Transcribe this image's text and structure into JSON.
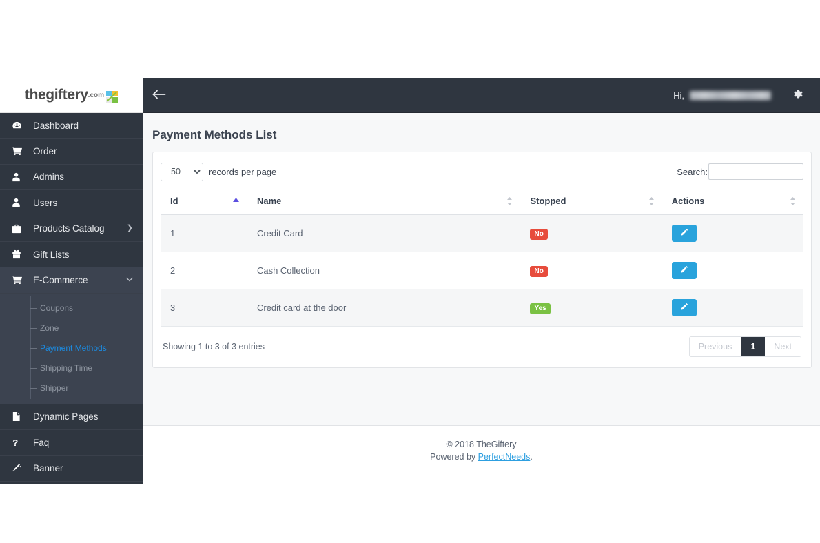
{
  "brand": {
    "name": "thegiftery",
    "suffix": ".com",
    "mark_icon": "gift-squares-logo-icon"
  },
  "sidebar": {
    "items": [
      {
        "label": "Dashboard",
        "icon": "dashboard-icon",
        "glyph": "◔",
        "caret": "",
        "active": false
      },
      {
        "label": "Order",
        "icon": "cart-icon",
        "glyph": "🛒",
        "caret": "",
        "active": false
      },
      {
        "label": "Admins",
        "icon": "user-icon",
        "glyph": "👤",
        "caret": "",
        "active": false
      },
      {
        "label": "Users",
        "icon": "user-icon",
        "glyph": "👤",
        "caret": "",
        "active": false
      },
      {
        "label": "Products Catalog",
        "icon": "briefcase-icon",
        "glyph": "💼",
        "caret": "❯",
        "active": false
      },
      {
        "label": "Gift Lists",
        "icon": "gift-icon",
        "glyph": "🎁",
        "caret": "",
        "active": false
      },
      {
        "label": "E-Commerce",
        "icon": "cart-icon",
        "glyph": "🛒",
        "caret": "⌄",
        "active": true
      }
    ],
    "submenu": [
      {
        "label": "Coupons",
        "active": false
      },
      {
        "label": "Zone",
        "active": false
      },
      {
        "label": "Payment Methods",
        "active": true
      },
      {
        "label": "Shipping Time",
        "active": false
      },
      {
        "label": "Shipper",
        "active": false
      }
    ],
    "items_bottom": [
      {
        "label": "Dynamic Pages",
        "icon": "file-icon",
        "glyph": "🗎"
      },
      {
        "label": "Faq",
        "icon": "question-mark-icon",
        "glyph": "?"
      },
      {
        "label": "Banner",
        "icon": "magic-wand-icon",
        "glyph": "✒"
      }
    ],
    "active_color": "#1b8ce3"
  },
  "topbar": {
    "back_icon": "back-arrow-icon",
    "back_glyph": "←",
    "greeting": "Hi,",
    "username_redacted": "",
    "gear_icon": "gear-icon",
    "gear_glyph": "⚙"
  },
  "page": {
    "title": "Payment Methods List"
  },
  "controls": {
    "per_page_value": "50",
    "per_page_options": [
      "50"
    ],
    "per_page_label": "records per page",
    "search_label": "Search:",
    "search_value": "",
    "search_placeholder": ""
  },
  "table": {
    "columns": [
      {
        "label": "Id",
        "sort": "asc"
      },
      {
        "label": "Name",
        "sort": "none"
      },
      {
        "label": "Stopped",
        "sort": "none"
      },
      {
        "label": "Actions",
        "sort": "none"
      }
    ],
    "rows": [
      {
        "id": "1",
        "name": "Credit Card",
        "stopped": "No",
        "stopped_state": "no",
        "action_icon": "edit-pencil-icon"
      },
      {
        "id": "2",
        "name": "Cash Collection",
        "stopped": "No",
        "stopped_state": "no",
        "action_icon": "edit-pencil-icon"
      },
      {
        "id": "3",
        "name": "Credit card at the door",
        "stopped": "Yes",
        "stopped_state": "yes",
        "action_icon": "edit-pencil-icon"
      }
    ],
    "badge_colors": {
      "no": "#e74c3c",
      "yes": "#7ac143"
    },
    "action_button_color": "#29a3dc"
  },
  "pagination": {
    "info": "Showing 1 to 3 of 3 entries",
    "previous_label": "Previous",
    "current_page": "1",
    "next_label": "Next"
  },
  "footer": {
    "copyright": "© 2018 TheGiftery",
    "powered_prefix": "Powered by ",
    "powered_link": "PerfectNeeds",
    "powered_suffix": "."
  }
}
